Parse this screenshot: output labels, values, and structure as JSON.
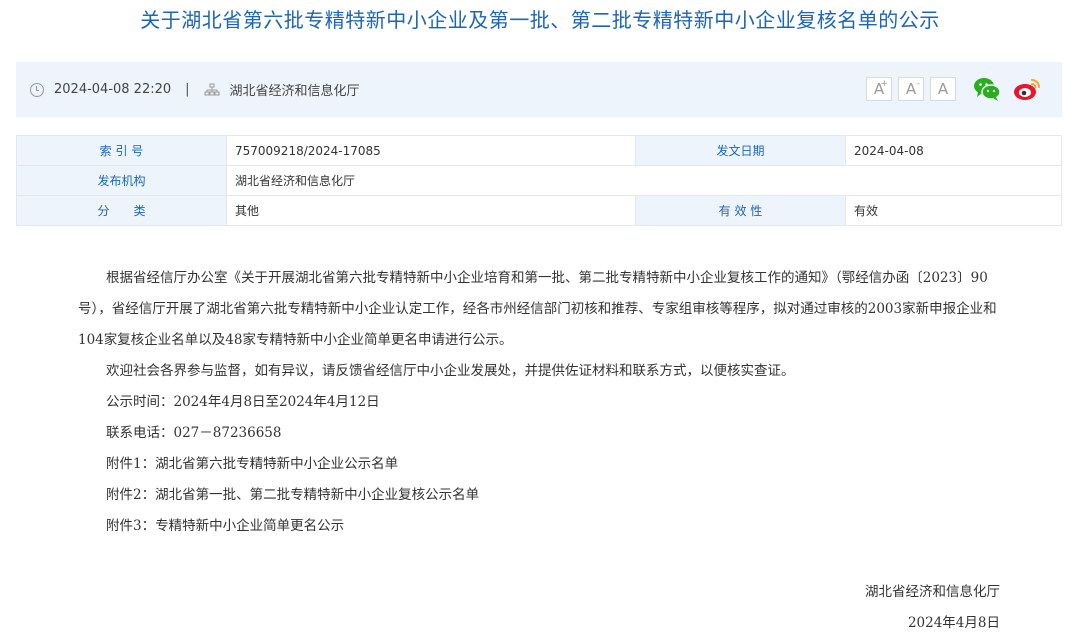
{
  "title": "关于湖北省第六批专精特新中小企业及第一批、第二批专精特新中小企业复核名单的公示",
  "infobar": {
    "datetime": "2024-04-08 22:20",
    "separator": "|",
    "source": "湖北省经济和信息化厅",
    "font_buttons": [
      "A",
      "A",
      "A"
    ],
    "font_button_marks": [
      "+",
      "-"
    ],
    "share_icons": [
      "wechat-icon",
      "weibo-icon"
    ]
  },
  "meta": {
    "index_label": "索 引 号",
    "index_value": "757009218/2024-17085",
    "date_label": "发文日期",
    "date_value": "2024-04-08",
    "issuer_label": "发布机构",
    "issuer_value": "湖北省经济和信息化厅",
    "category_label": "分　　类",
    "category_value": "其他",
    "validity_label": "有 效 性",
    "validity_value": "有效"
  },
  "content": {
    "paragraph1": "根据省经信厅办公室《关于开展湖北省第六批专精特新中小企业培育和第一批、第二批专精特新中小企业复核工作的通知》（鄂经信办函〔2023〕90号），省经信厅开展了湖北省第六批专精特新中小企业认定工作，经各市州经信部门初核和推荐、专家组审核等程序，拟对通过审核的2003家新申报企业和104家复核企业名单以及48家专精特新中小企业简单更名申请进行公示。",
    "paragraph2": "欢迎社会各界参与监督，如有异议，请反馈省经信厅中小企业发展处，并提供佐证材料和联系方式，以便核实查证。",
    "period": "公示时间：2024年4月8日至2024年4月12日",
    "phone": "联系电话：027－87236658",
    "attachment1": "附件1：湖北省第六批专精特新中小企业公示名单",
    "attachment2": "附件2：湖北省第一批、第二批专精特新中小企业复核公示名单",
    "attachment3": "附件3：专精特新中小企业简单更名公示"
  },
  "signature": {
    "org": "湖北省经济和信息化厅",
    "date": "2024年4月8日"
  },
  "colors": {
    "title": "#1b66b8",
    "infobar_bg": "#eef4fb",
    "wechat": "#2aae1f",
    "weibo": "#e6162d"
  }
}
